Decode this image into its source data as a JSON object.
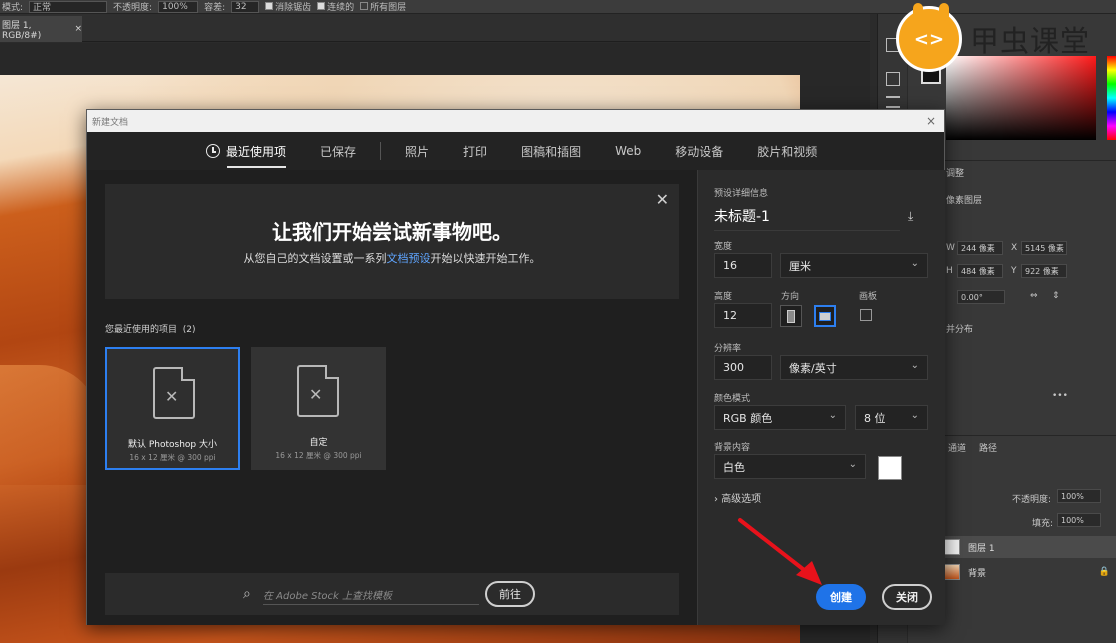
{
  "options_bar": {
    "mode_label": "模式:",
    "mode_value": "正常",
    "opacity_label": "不透明度:",
    "opacity_value": "100%",
    "tolerance_label": "容差:",
    "tolerance_value": "32",
    "antialias_label": "消除锯齿",
    "contiguous_label": "连续的",
    "all_layers_label": "所有图层"
  },
  "doc_tab": {
    "title": "图层 1, RGB/8#)",
    "close": "×"
  },
  "logo": {
    "text": "甲虫课堂"
  },
  "right_panel": {
    "adjust_tab": "调整",
    "pixel_layer": "像素图层",
    "w_label": "W",
    "w_value": "244 像素",
    "h_label": "H",
    "h_value": "484 像素",
    "x_label": "X",
    "x_value": "5145 像素",
    "y_label": "Y",
    "y_value": "922 像素",
    "angle_value": "0.00°",
    "distribute_label": "并分布",
    "more": "•••",
    "channels_tab": "通道",
    "paths_tab": "路径",
    "opacity_label": "不透明度:",
    "opacity_value": "100%",
    "fill_label": "填充:",
    "fill_value": "100%",
    "layers": [
      {
        "name": "图层 1"
      },
      {
        "name": "背景"
      }
    ]
  },
  "dialog": {
    "title": "新建文档",
    "close_x": "×",
    "tabs": [
      {
        "label": "最近使用项"
      },
      {
        "label": "已保存"
      },
      {
        "label": "照片"
      },
      {
        "label": "打印"
      },
      {
        "label": "图稿和插图"
      },
      {
        "label": "Web"
      },
      {
        "label": "移动设备"
      },
      {
        "label": "胶片和视频"
      }
    ],
    "welcome": {
      "heading": "让我们开始尝试新事物吧。",
      "sub_before": "从您自己的文档设置或一系列",
      "sub_link": "文档预设",
      "sub_after": "开始以快速开始工作。",
      "close": "✕"
    },
    "recent_heading": "您最近使用的项目",
    "recent_count": "(2)",
    "recent_items": [
      {
        "name": "默认 Photoshop 大小",
        "size": "16 x 12 厘米 @ 300 ppi"
      },
      {
        "name": "自定",
        "size": "16 x 12 厘米 @ 300 ppi"
      }
    ],
    "stock": {
      "placeholder": "在 Adobe Stock 上查找模板",
      "go_label": "前往"
    },
    "details": {
      "section_label": "预设详细信息",
      "preset_name": "未标题-1",
      "width_label": "宽度",
      "width_value": "16",
      "width_unit": "厘米",
      "height_label": "高度",
      "height_value": "12",
      "orientation_label": "方向",
      "artboard_label": "画板",
      "resolution_label": "分辨率",
      "resolution_value": "300",
      "resolution_unit": "像素/英寸",
      "color_mode_label": "颜色模式",
      "color_mode_value": "RGB 颜色",
      "bit_depth_value": "8 位",
      "bg_label": "背景内容",
      "bg_value": "白色",
      "advanced_label": "高级选项",
      "create_label": "创建",
      "close_label": "关闭"
    }
  },
  "colors": {
    "accent_blue": "#1f73e8",
    "annotation_red": "#e8121b",
    "logo_orange": "#f6a51c"
  }
}
